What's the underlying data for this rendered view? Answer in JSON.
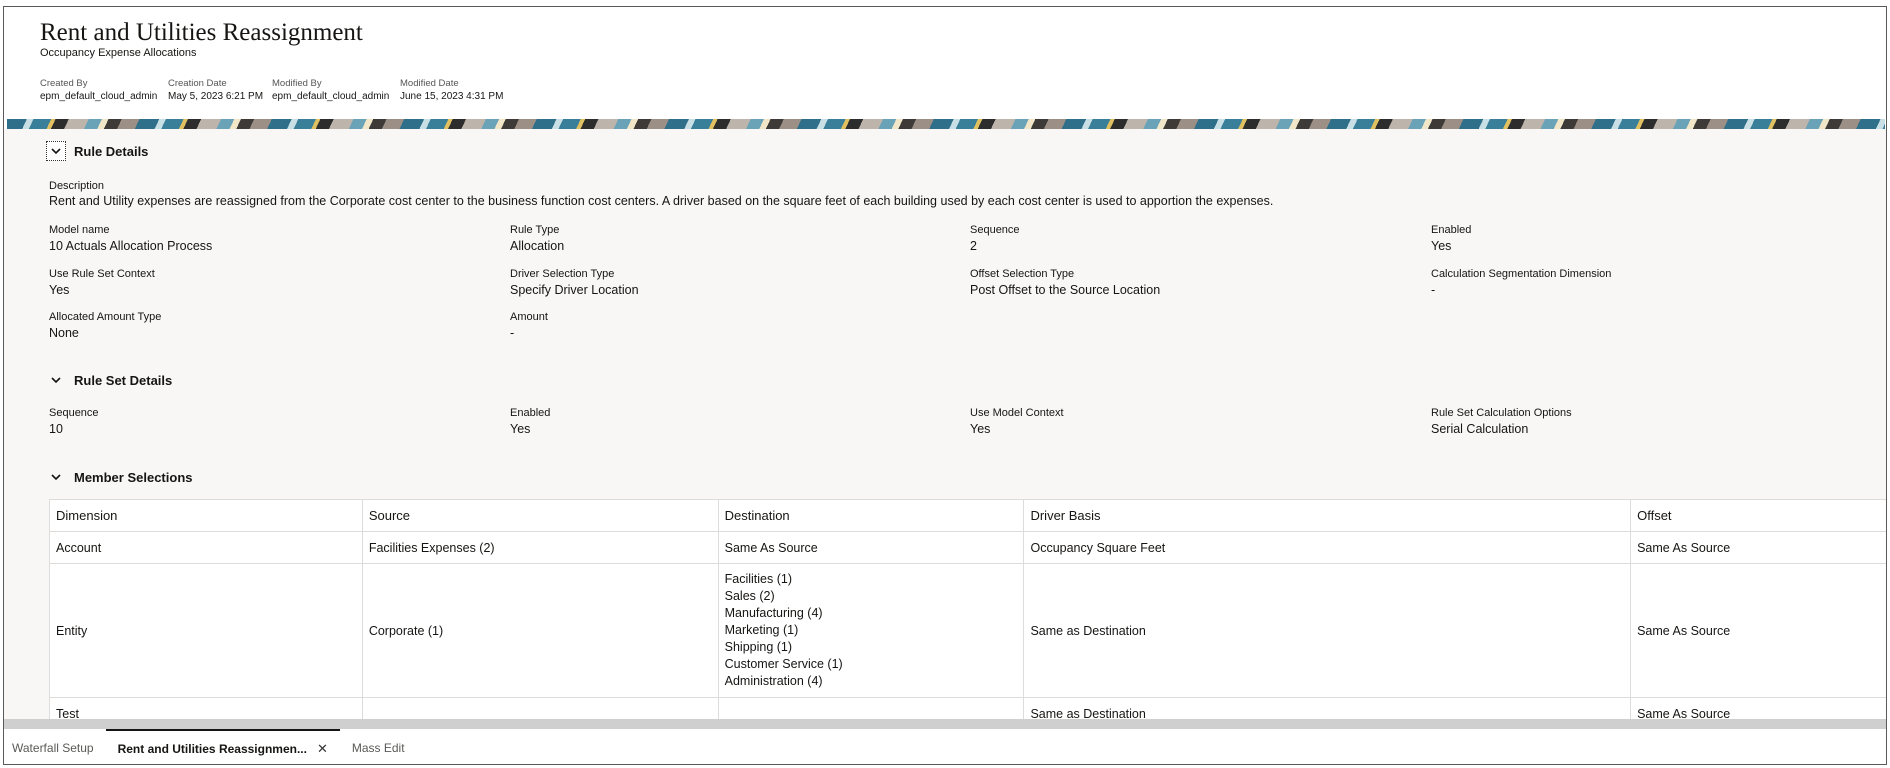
{
  "header": {
    "title": "Rent and Utilities Reassignment",
    "subtitle": "Occupancy Expense Allocations",
    "meta": [
      {
        "label": "Created By",
        "value": "epm_default_cloud_admin"
      },
      {
        "label": "Creation Date",
        "value": "May 5, 2023 6:21 PM"
      },
      {
        "label": "Modified By",
        "value": "epm_default_cloud_admin"
      },
      {
        "label": "Modified Date",
        "value": "June 15, 2023 4:31 PM"
      }
    ]
  },
  "rule_details": {
    "title": "Rule Details",
    "chevron_icon": "chevron-down-icon",
    "description_label": "Description",
    "description": "Rent and Utility expenses are reassigned from the Corporate cost center to the business function cost centers. A driver based on the square feet of each building used by each cost center is used to apportion the expenses.",
    "fields": [
      {
        "label": "Model name",
        "value": "10 Actuals Allocation Process"
      },
      {
        "label": "Rule Type",
        "value": "Allocation"
      },
      {
        "label": "Sequence",
        "value": "2"
      },
      {
        "label": "Enabled",
        "value": "Yes"
      },
      {
        "label": "Use Rule Set Context",
        "value": "Yes"
      },
      {
        "label": "Driver Selection Type",
        "value": "Specify Driver Location"
      },
      {
        "label": "Offset Selection Type",
        "value": "Post Offset to the Source Location"
      },
      {
        "label": "Calculation Segmentation Dimension",
        "value": "-"
      },
      {
        "label": "Allocated Amount Type",
        "value": "None"
      },
      {
        "label": "Amount",
        "value": "-"
      }
    ]
  },
  "rule_set_details": {
    "title": "Rule Set Details",
    "fields": [
      {
        "label": "Sequence",
        "value": "10"
      },
      {
        "label": "Enabled",
        "value": "Yes"
      },
      {
        "label": "Use Model Context",
        "value": "Yes"
      },
      {
        "label": "Rule Set Calculation Options",
        "value": "Serial Calculation"
      }
    ]
  },
  "member_selections": {
    "title": "Member Selections",
    "columns": [
      "Dimension",
      "Source",
      "Destination",
      "Driver Basis",
      "Offset"
    ],
    "rows": [
      {
        "dimension": "Account",
        "source": "Facilities Expenses (2)",
        "destination": [
          "Same As Source"
        ],
        "driver_basis": "Occupancy Square Feet",
        "offset": "Same As Source"
      },
      {
        "dimension": "Entity",
        "source": "Corporate (1)",
        "destination": [
          "Facilities (1)",
          "Sales (2)",
          "Manufacturing (4)",
          "Marketing (1)",
          "Shipping (1)",
          "Customer Service (1)",
          "Administration (4)"
        ],
        "driver_basis": "Same as Destination",
        "offset": "Same As Source"
      },
      {
        "dimension": "Test",
        "source": "",
        "destination": [
          ""
        ],
        "driver_basis": "Same as Destination",
        "offset": "Same As Source"
      }
    ]
  },
  "tabs": [
    {
      "label": "Waterfall Setup",
      "active": false
    },
    {
      "label": "Rent and Utilities Reassignmen...",
      "active": true,
      "close_icon": "close-icon"
    },
    {
      "label": "Mass Edit",
      "active": false
    }
  ],
  "colors": {
    "text": "#161513",
    "content_bg": "#f8f7f6",
    "border": "#dedcda",
    "scrollbar": "#cfcfcf"
  }
}
